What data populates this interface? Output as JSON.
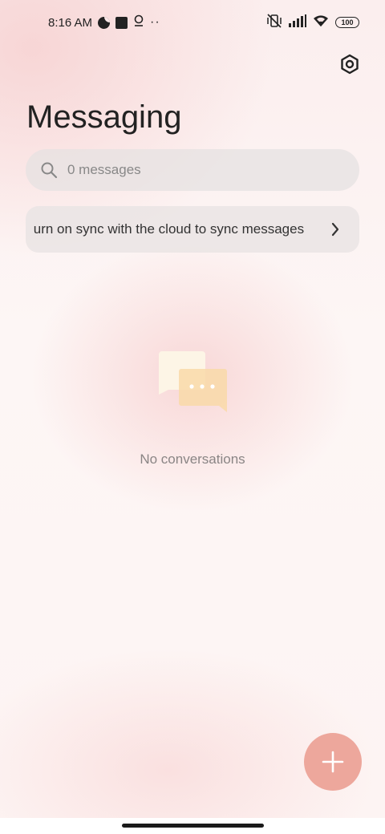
{
  "status_bar": {
    "time": "8:16 AM",
    "battery": "100"
  },
  "header": {
    "title": "Messaging",
    "settings_icon": "settings-hexagon-icon"
  },
  "search": {
    "placeholder": "0 messages",
    "icon": "search-icon"
  },
  "sync_banner": {
    "text": "Turn on sync with the cloud to sync messages",
    "icon": "chevron-right-icon"
  },
  "empty_state": {
    "icon": "chat-bubbles-icon",
    "text": "No conversations"
  },
  "fab": {
    "icon": "plus-icon"
  },
  "colors": {
    "fab": "#eda79c",
    "bubble_back": "#fdf5e6",
    "bubble_front": "#f9d9a8"
  }
}
